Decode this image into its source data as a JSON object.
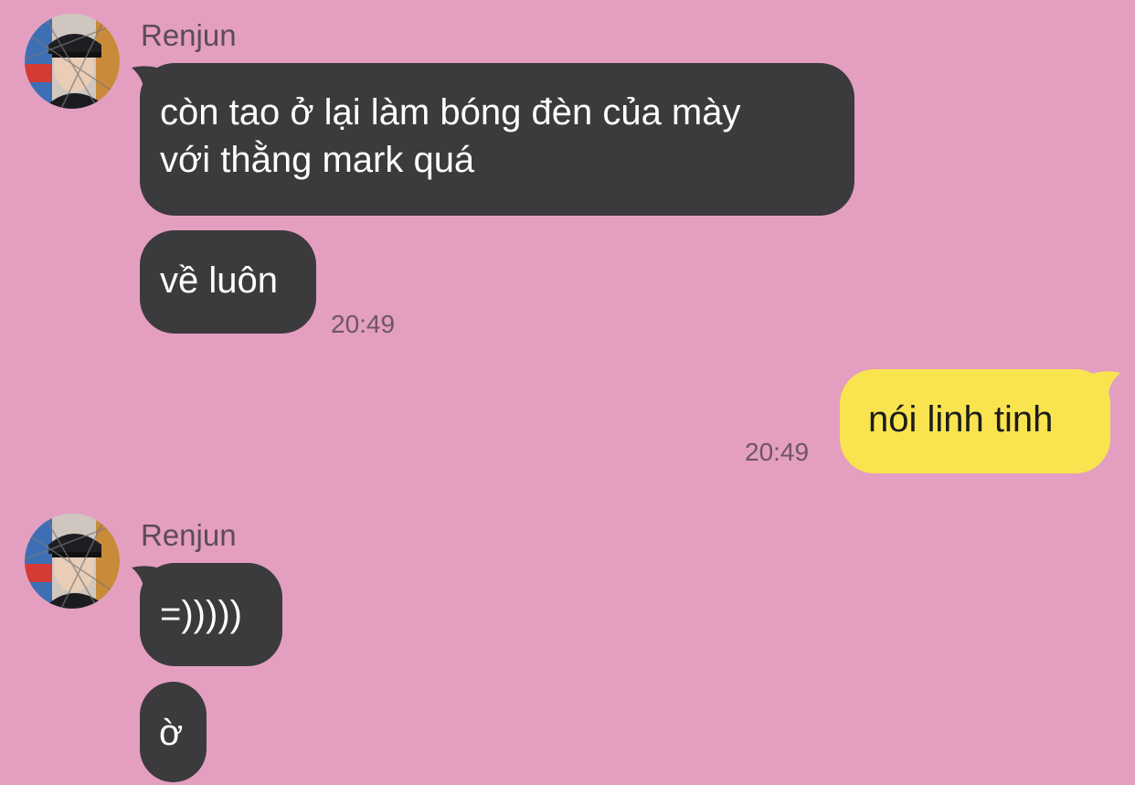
{
  "colors": {
    "background": "#e49fc0",
    "incoming_bubble": "#3b3a3c",
    "outgoing_bubble": "#f9e44f",
    "timestamp": "#6e5666"
  },
  "messages": [
    {
      "sender": "Renjun",
      "avatar_icon": "profile-photo-avatar",
      "lines": [
        "còn tao ở lại làm bóng đèn của mày",
        "với thằng mark quá"
      ]
    },
    {
      "text": "về luôn",
      "time": "20:49"
    },
    {
      "text": "nói linh tinh",
      "time": "20:49",
      "direction": "outgoing"
    },
    {
      "sender": "Renjun",
      "avatar_icon": "profile-photo-avatar",
      "text": "=)))))"
    },
    {
      "text": "ờ"
    }
  ]
}
